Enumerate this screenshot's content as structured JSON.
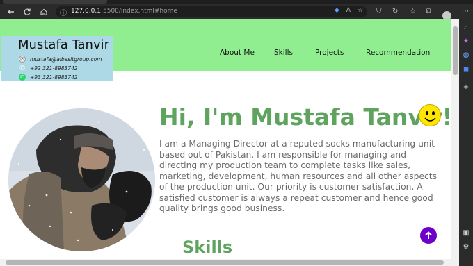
{
  "browser": {
    "address_url": "127.0.0.1",
    "address_url_rest": ":5500/index.html#home"
  },
  "site": {
    "brand": "Mustafa Tanvir",
    "contact": {
      "email": "mustafa@albasitgroup.com",
      "phone": "+92 321-8983742",
      "whatsapp": "+93 321-8983742"
    },
    "nav": [
      "About Me",
      "Skills",
      "Projects",
      "Recommendation"
    ]
  },
  "hero": {
    "title": "Hi, I'm Mustafa Tanvir!",
    "description": "I am a Managing Director at a reputed socks manufacturing unit based out of Pakistan. I am responsible for managing and directing my production team to complete tasks like sales, marketing, development, human resources and all other aspects of the production unit. Our priority is customer satisfaction. A satisfied customer is always a repeat customer and hence good quality brings good business."
  },
  "skills": {
    "heading": "Skills"
  },
  "colors": {
    "header_bg": "#90ee90",
    "contact_bg": "#add8e6",
    "accent_green": "#5ea35e",
    "to_top_purple": "#6f00c9"
  }
}
